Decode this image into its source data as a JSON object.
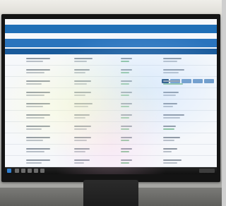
{
  "colors": {
    "topbar": "#1f6fb7",
    "bluebar": "#2a74bd",
    "navbar": "#195a9b",
    "accent_green": "#64a37b",
    "taskbar": "#111111"
  },
  "icons": {
    "windows_start": "windows-start-icon",
    "taskbar_apps": [
      "folder-icon",
      "browser-icon",
      "app-icon",
      "app-icon",
      "app-icon"
    ]
  },
  "rows_count_visible": 10
}
